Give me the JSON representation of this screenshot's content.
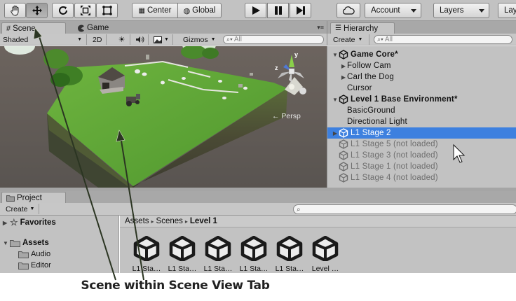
{
  "toolbar": {
    "tools": [
      "hand-icon",
      "move-icon",
      "rotate-icon",
      "scale-icon",
      "rect-icon"
    ],
    "pivot_label": "Center",
    "space_label": "Global",
    "play_icons": [
      "play-icon",
      "pause-icon",
      "step-icon"
    ],
    "cloud_icon": "cloud-icon",
    "account_label": "Account",
    "layers_label": "Layers",
    "layout_label": "Lay"
  },
  "scene_panel": {
    "tabs": [
      {
        "label": "Scene",
        "icon": "grid-icon"
      },
      {
        "label": "Game",
        "icon": "pacman-icon"
      }
    ],
    "draw_mode": "Shaded",
    "mode_2d": "2D",
    "gizmos_label": "Gizmos",
    "search_placeholder": "All",
    "persp_label": "← Persp",
    "gizmo_axes": {
      "y": "y",
      "z": "z"
    }
  },
  "hierarchy": {
    "tab_label": "Hierarchy",
    "create_label": "Create",
    "search_placeholder": "All",
    "rows": [
      {
        "label": "Game Core*",
        "kind": "scene",
        "fold": "▼"
      },
      {
        "label": "Follow Cam",
        "kind": "child",
        "fold": "▶"
      },
      {
        "label": "Carl the Dog",
        "kind": "child",
        "fold": "▶"
      },
      {
        "label": "Cursor",
        "kind": "child",
        "fold": ""
      },
      {
        "label": "Level 1 Base Environment*",
        "kind": "scene",
        "fold": "▼"
      },
      {
        "label": "BasicGround",
        "kind": "child",
        "fold": ""
      },
      {
        "label": "Directional Light",
        "kind": "child",
        "fold": ""
      },
      {
        "label": "L1 Stage 2",
        "kind": "selected",
        "fold": "▶"
      },
      {
        "label": "L1 Stage 5 (not loaded)",
        "kind": "dim",
        "fold": ""
      },
      {
        "label": "L1 Stage 3 (not loaded)",
        "kind": "dim",
        "fold": ""
      },
      {
        "label": "L1 Stage 1 (not loaded)",
        "kind": "dim",
        "fold": ""
      },
      {
        "label": "L1 Stage 4 (not loaded)",
        "kind": "dim",
        "fold": ""
      }
    ]
  },
  "project": {
    "tab_label": "Project",
    "create_label": "Create",
    "favorites_label": "Favorites",
    "assets_label": "Assets",
    "folders": [
      "Audio",
      "Editor"
    ],
    "breadcrumb": [
      "Assets",
      "Scenes",
      "Level 1"
    ],
    "breadcrumb_sep": "▸",
    "asset_items": [
      "L1 Sta…",
      "L1 Sta…",
      "L1 Sta…",
      "L1 Sta…",
      "L1 Sta…",
      "Level …"
    ]
  },
  "caption": "Scene within Scene View Tab",
  "colors": {
    "selection": "#3d80df",
    "panel": "#c2c2c2",
    "grass": "#62a638",
    "arrow": "#2b3522"
  }
}
